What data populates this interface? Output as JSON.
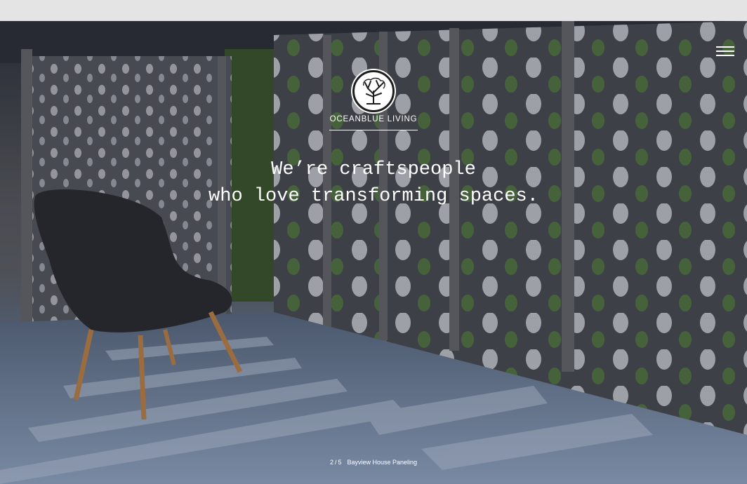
{
  "hero": {
    "logo": {
      "brand": "OCEANBLUE LIVING",
      "icon": "tree-icon"
    },
    "headline": {
      "line1": "We’re craftspeople",
      "line2": "who love transforming spaces."
    },
    "menu": {
      "icon": "hamburger-menu-icon"
    },
    "slide": {
      "current": "2",
      "total": "5",
      "separator": "/",
      "caption": "Bayview House Paneling"
    }
  },
  "colors": {
    "text": "#ffffff",
    "floor": "#8aa0bf",
    "panel": "#5c5e62",
    "chair": "#2b2d31",
    "chair_legs": "#c98a4b"
  }
}
